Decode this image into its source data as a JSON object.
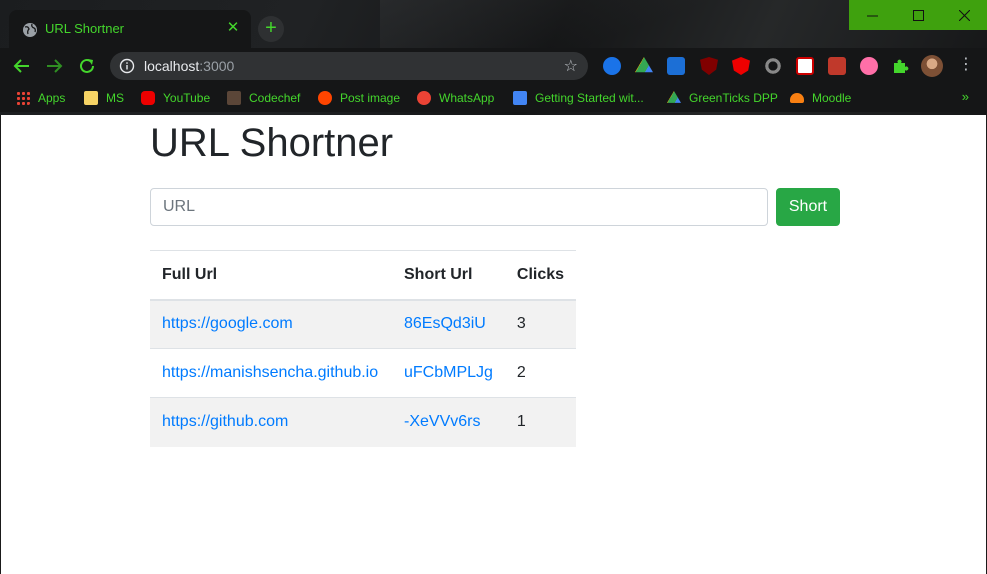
{
  "browser": {
    "tab_title": "URL Shortner",
    "omnibox": {
      "host": "localhost",
      "port": ":3000"
    },
    "accent_color": "#44d62c",
    "bookmarks": [
      {
        "label": "Apps",
        "icon": "apps-grid-icon"
      },
      {
        "label": "MS",
        "icon": "folder-icon"
      },
      {
        "label": "YouTube",
        "icon": "youtube-icon"
      },
      {
        "label": "Codechef",
        "icon": "codechef-icon"
      },
      {
        "label": "Post image",
        "icon": "reddit-icon"
      },
      {
        "label": "WhatsApp",
        "icon": "alert-icon"
      },
      {
        "label": "Getting Started wit...",
        "icon": "docs-icon"
      },
      {
        "label": "GreenTicks DPP",
        "icon": "drive-icon"
      },
      {
        "label": "Moodle",
        "icon": "moodle-icon"
      }
    ],
    "bookmarks_more": "»"
  },
  "page": {
    "heading": "URL Shortner",
    "input_placeholder": "URL",
    "submit_label": "Short",
    "table": {
      "headers": [
        "Full Url",
        "Short Url",
        "Clicks"
      ],
      "rows": [
        {
          "full": "https://google.com",
          "short": "86EsQd3iU",
          "clicks": "3"
        },
        {
          "full": "https://manishsencha.github.io",
          "short": "uFCbMPLJg",
          "clicks": "2"
        },
        {
          "full": "https://github.com",
          "short": "-XeVVv6rs",
          "clicks": "1"
        }
      ]
    }
  }
}
